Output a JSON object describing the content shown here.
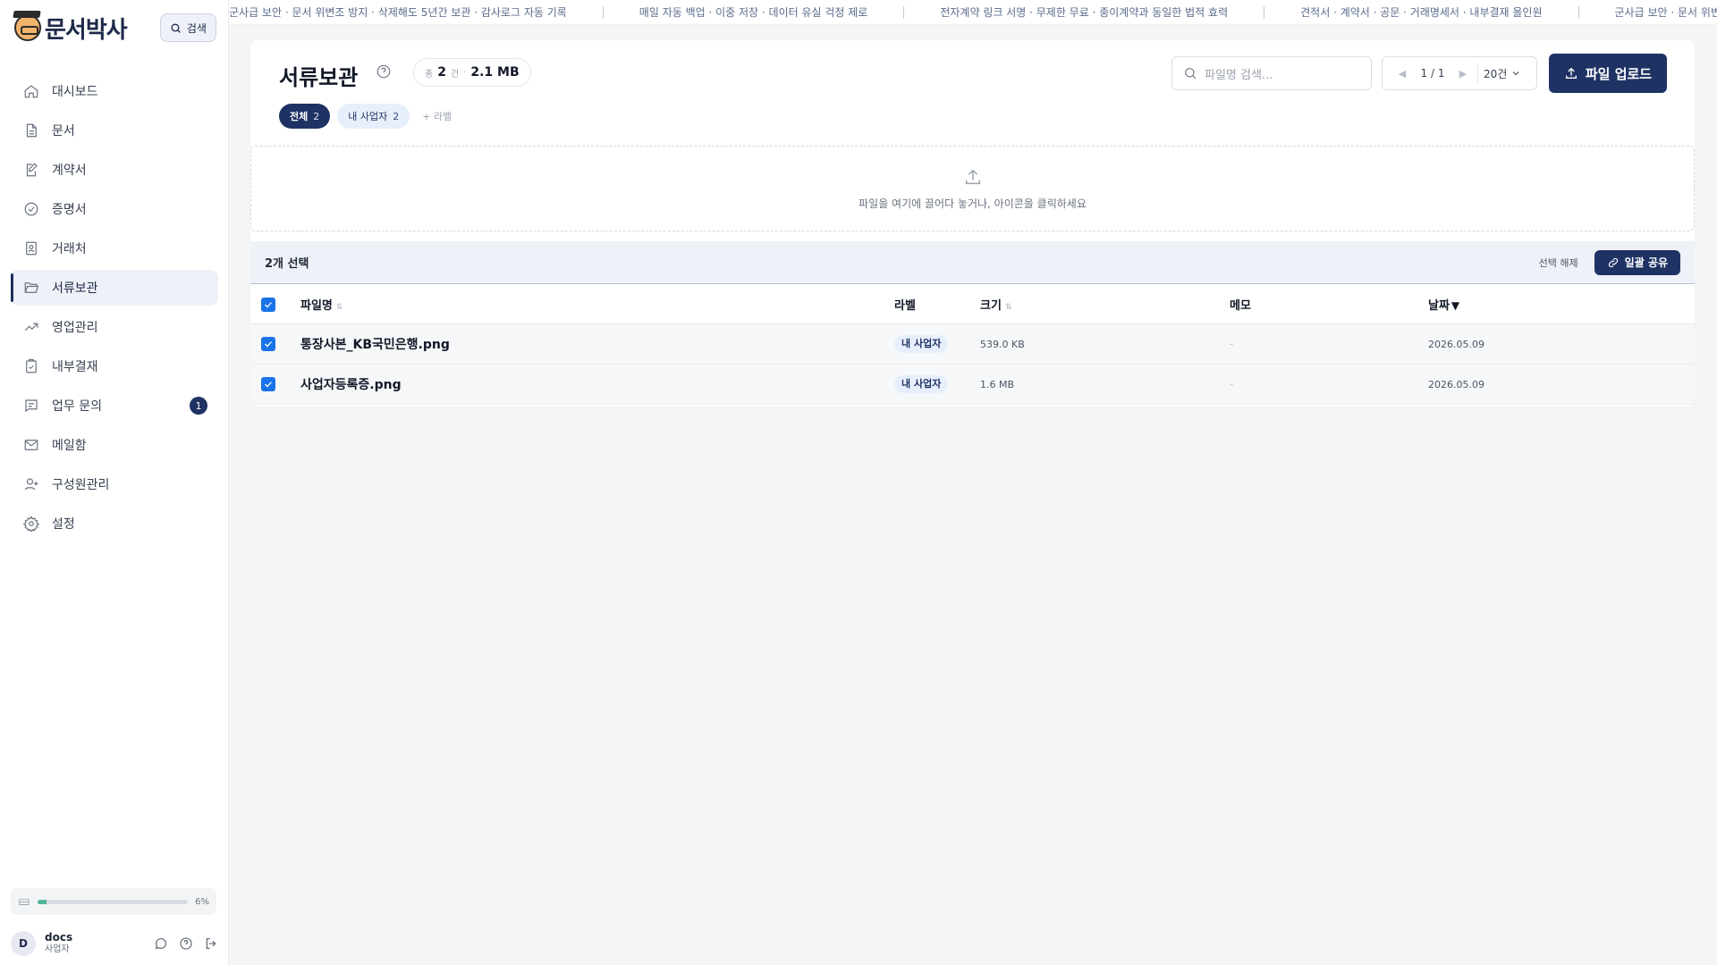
{
  "app": {
    "logo_text": "문서박사",
    "search_button_label": "검색"
  },
  "ticker": [
    "군사급 보안 · 문서 위변조 방지 · 삭제해도 5년간 보관 · 감사로그 자동 기록",
    "매일 자동 백업 · 이중 저장 · 데이터 유실 걱정 제로",
    "전자계약 링크 서명 · 무제한 무료 · 종이계약과 동일한 법적 효력",
    "견적서 · 계약서 · 공문 · 거래명세서 · 내부결재 올인원",
    "군사급 보안 · 문서 위변조 방지"
  ],
  "sidebar": {
    "items": [
      {
        "label": "대시보드",
        "icon": "home-icon"
      },
      {
        "label": "문서",
        "icon": "document-icon"
      },
      {
        "label": "계약서",
        "icon": "edit-document-icon"
      },
      {
        "label": "증명서",
        "icon": "check-circle-icon"
      },
      {
        "label": "거래처",
        "icon": "contact-card-icon"
      },
      {
        "label": "서류보관",
        "icon": "folder-open-icon",
        "active": true
      },
      {
        "label": "영업관리",
        "icon": "trending-up-icon"
      },
      {
        "label": "내부결재",
        "icon": "clipboard-check-icon"
      },
      {
        "label": "업무 문의",
        "icon": "message-list-icon",
        "badge": "1"
      },
      {
        "label": "메일함",
        "icon": "mail-icon"
      },
      {
        "label": "구성원관리",
        "icon": "user-plus-icon"
      },
      {
        "label": "설정",
        "icon": "gear-icon"
      }
    ],
    "storage": {
      "percent_label": "6%",
      "fraction": 0.06
    },
    "user": {
      "initial": "D",
      "name": "docs",
      "role": "사업자"
    }
  },
  "page": {
    "title": "서류보관",
    "count_prefix": "총",
    "count_value": "2",
    "count_unit": "건",
    "total_size": "2.1 MB",
    "search_placeholder": "파일명 검색...",
    "pager_text": "1 / 1",
    "page_size": "20건",
    "upload_label": "파일 업로드",
    "tabs": [
      {
        "label": "전체",
        "count": "2"
      },
      {
        "label": "내 사업자",
        "count": "2"
      }
    ],
    "add_label": "+ 라벨",
    "dropzone_text": "파일을 여기에 끌어다 놓거나, 아이콘을 클릭하세요"
  },
  "selection": {
    "count_label": "2개 선택",
    "clear_label": "선택 해제",
    "share_label": "일괄 공유"
  },
  "table": {
    "columns": {
      "name": "파일명",
      "label": "라벨",
      "size": "크기",
      "memo": "메모",
      "date": "날짜"
    },
    "rows": [
      {
        "name": "통장사본_KB국민은행.png",
        "label": "내 사업자",
        "size": "539.0 KB",
        "memo": "-",
        "date": "2026.05.09",
        "checked": true
      },
      {
        "name": "사업자등록증.png",
        "label": "내 사업자",
        "size": "1.6 MB",
        "memo": "-",
        "date": "2026.05.09",
        "checked": true
      }
    ]
  },
  "colors": {
    "primary": "#1e3263",
    "accent_checkbox": "#1a73e8",
    "storage_fill": "#4fb89a"
  }
}
